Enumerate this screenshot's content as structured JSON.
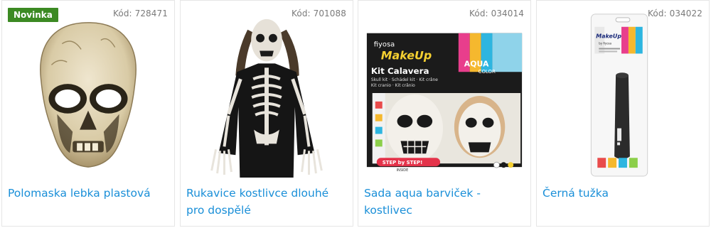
{
  "products": [
    {
      "badge": "Novinka",
      "code": "Kód: 728471",
      "name": "Polomaska lebka plastová",
      "image_icon": "skull-half-mask-image"
    },
    {
      "badge": "",
      "code": "Kód: 701088",
      "name": "Rukavice kostlivce dlouhé pro dospělé",
      "image_icon": "skeleton-shirt-gloves-image"
    },
    {
      "badge": "",
      "code": "Kód: 034014",
      "name": "Sada aqua barviček - kostlivec",
      "image_icon": "face-paint-kit-image",
      "packaging": {
        "brand": "fiyosa",
        "line": "MakeUp",
        "title": "Kit Calavera",
        "subtitle_1": "Skull kit · Schädel kit · Kit crâne",
        "subtitle_2": "Kit cranio · Kit crânio",
        "aqua": "AQUA",
        "color": "COLOR",
        "step": "STEP by STEP!",
        "inside": "INSIDE"
      }
    },
    {
      "badge": "",
      "code": "Kód: 034022",
      "name": "Černá tužka",
      "image_icon": "black-makeup-pencil-image",
      "packaging": {
        "line": "MakeUp",
        "brand": "by fiyosa"
      }
    }
  ],
  "colors": {
    "link": "#1a8fd8",
    "badge": "#3c8a23",
    "code": "#7a7a7a",
    "border": "#e6e6e6"
  }
}
